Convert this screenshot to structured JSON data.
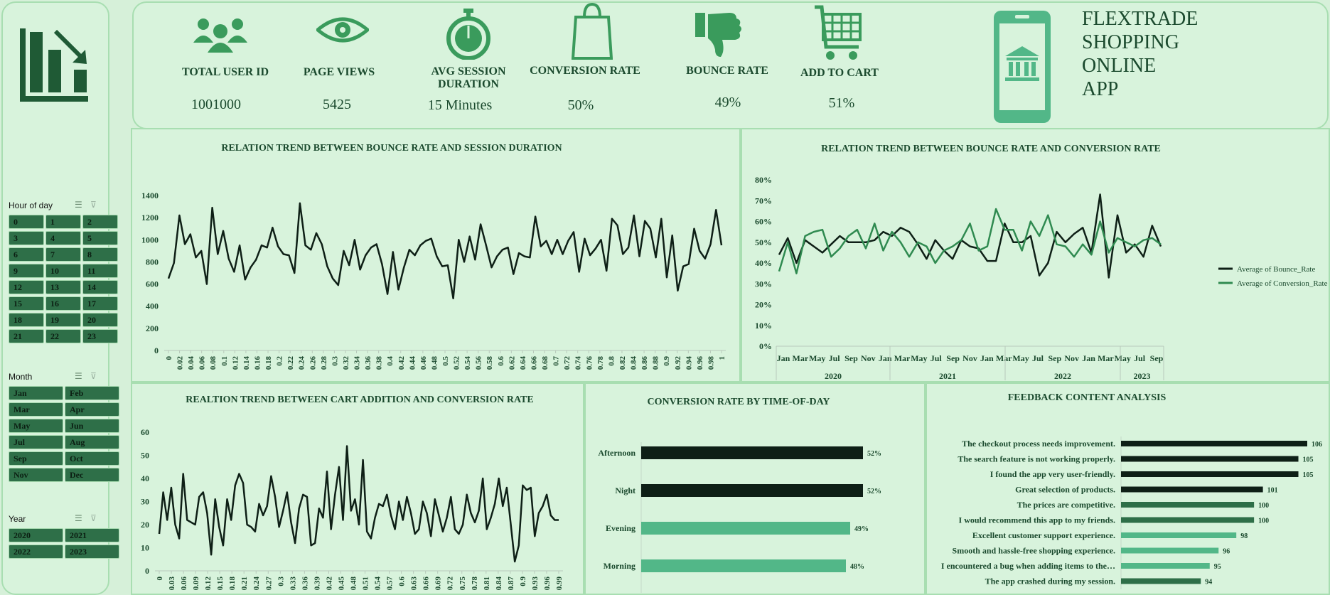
{
  "kpis": [
    {
      "icon": "users-icon",
      "label": "TOTAL USER ID",
      "value": "1001000"
    },
    {
      "icon": "eye-icon",
      "label": "PAGE VIEWS",
      "value": "5425"
    },
    {
      "icon": "stopwatch-icon",
      "label": "AVG SESSION DURATION",
      "value": "15 Minutes"
    },
    {
      "icon": "shopping-bag-icon",
      "label": "CONVERSION RATE",
      "value": "50%"
    },
    {
      "icon": "thumbs-down-icon",
      "label": "BOUNCE RATE",
      "value": "49%"
    },
    {
      "icon": "cart-icon",
      "label": "ADD TO CART",
      "value": "51%"
    }
  ],
  "brand": {
    "line1": "FLEXTRADE",
    "line2": "SHOPPING",
    "line3": "ONLINE",
    "line4": "APP"
  },
  "slicers": {
    "hour": {
      "title": "Hour of day",
      "items": [
        "0",
        "1",
        "2",
        "3",
        "4",
        "5",
        "6",
        "7",
        "8",
        "9",
        "10",
        "11",
        "12",
        "13",
        "14",
        "15",
        "16",
        "17",
        "18",
        "19",
        "20",
        "21",
        "22",
        "23"
      ]
    },
    "month": {
      "title": "Month",
      "items": [
        "Jan",
        "Feb",
        "Mar",
        "Apr",
        "May",
        "Jun",
        "Jul",
        "Aug",
        "Sep",
        "Oct",
        "Nov",
        "Dec"
      ]
    },
    "year": {
      "title": "Year",
      "items": [
        "2020",
        "2021",
        "2022",
        "2023"
      ]
    }
  },
  "colors": {
    "dark": "#0e1f16",
    "green": "#3a9b5c",
    "light_green": "#52b788",
    "bg": "#d8f3dc",
    "accent": "#2e6f48"
  },
  "chart_data": [
    {
      "type": "line",
      "title": "RELATION TREND BETWEEN BOUNCE RATE AND SESSION DURATION",
      "ylim": [
        0,
        1400
      ],
      "yticks": [
        "0",
        "200",
        "400",
        "600",
        "800",
        "1000",
        "1200",
        "1400"
      ],
      "xtick_labels": [
        "0",
        "0.02",
        "0.04",
        "0.06",
        "0.08",
        "0.1",
        "0.12",
        "0.14",
        "0.16",
        "0.18",
        "0.2",
        "0.22",
        "0.24",
        "0.26",
        "0.28",
        "0.3",
        "0.32",
        "0.34",
        "0.36",
        "0.38",
        "0.4",
        "0.42",
        "0.44",
        "0.46",
        "0.48",
        "0.5",
        "0.52",
        "0.54",
        "0.56",
        "0.58",
        "0.6",
        "0.62",
        "0.64",
        "0.66",
        "0.68",
        "0.7",
        "0.72",
        "0.74",
        "0.76",
        "0.78",
        "0.8",
        "0.82",
        "0.84",
        "0.86",
        "0.88",
        "0.9",
        "0.92",
        "0.94",
        "0.96",
        "0.98",
        "1"
      ],
      "values": [
        650,
        790,
        1220,
        960,
        1050,
        840,
        900,
        600,
        1290,
        870,
        1080,
        830,
        710,
        950,
        640,
        750,
        820,
        950,
        930,
        1110,
        940,
        870,
        860,
        700,
        1330,
        950,
        910,
        1060,
        960,
        760,
        650,
        590,
        900,
        770,
        1000,
        730,
        860,
        930,
        960,
        780,
        510,
        890,
        550,
        750,
        910,
        860,
        950,
        990,
        1010,
        850,
        760,
        770,
        470,
        1000,
        800,
        1030,
        820,
        1140,
        950,
        750,
        850,
        910,
        930,
        690,
        880,
        850,
        840,
        1210,
        940,
        990,
        870,
        1000,
        870,
        990,
        1070,
        710,
        1010,
        860,
        920,
        1000,
        720,
        1190,
        1130,
        870,
        930,
        1220,
        850,
        1170,
        1100,
        840,
        1190,
        660,
        1040,
        540,
        760,
        780,
        1100,
        900,
        830,
        960,
        1270,
        950
      ]
    },
    {
      "type": "line",
      "title": "RELATION TREND BETWEEN BOUNCE RATE AND CONVERSION RATE",
      "ylim": [
        0,
        0.8
      ],
      "yticks": [
        "0%",
        "10%",
        "20%",
        "30%",
        "40%",
        "50%",
        "60%",
        "70%",
        "80%"
      ],
      "month_labels": [
        "Jan",
        "Mar",
        "May",
        "Jul",
        "Sep",
        "Nov",
        "Jan",
        "Mar",
        "May",
        "Jul",
        "Sep",
        "Nov",
        "Jan",
        "Mar",
        "May",
        "Jul",
        "Sep",
        "Nov",
        "Jan",
        "Mar",
        "May",
        "Jul",
        "Sep"
      ],
      "year_labels": [
        "2020",
        "2021",
        "2022",
        "2023"
      ],
      "legend_position": "right",
      "series": [
        {
          "name": "Average of Bounce_Rate",
          "values": [
            0.44,
            0.52,
            0.4,
            0.51,
            0.48,
            0.45,
            0.49,
            0.53,
            0.5,
            0.5,
            0.5,
            0.51,
            0.55,
            0.53,
            0.57,
            0.55,
            0.49,
            0.42,
            0.51,
            0.46,
            0.42,
            0.51,
            0.48,
            0.47,
            0.41,
            0.41,
            0.59,
            0.5,
            0.5,
            0.53,
            0.34,
            0.4,
            0.55,
            0.5,
            0.54,
            0.57,
            0.45,
            0.73,
            0.33,
            0.63,
            0.45,
            0.49,
            0.43,
            0.58,
            0.48
          ]
        },
        {
          "name": "Average of Conversion_Rate",
          "values": [
            0.36,
            0.5,
            0.35,
            0.53,
            0.55,
            0.56,
            0.43,
            0.47,
            0.53,
            0.56,
            0.47,
            0.59,
            0.46,
            0.55,
            0.5,
            0.43,
            0.5,
            0.48,
            0.4,
            0.46,
            0.48,
            0.51,
            0.59,
            0.46,
            0.48,
            0.66,
            0.56,
            0.56,
            0.46,
            0.6,
            0.53,
            0.63,
            0.49,
            0.48,
            0.43,
            0.49,
            0.44,
            0.6,
            0.45,
            0.52,
            0.5,
            0.48,
            0.51,
            0.52,
            0.49
          ]
        }
      ]
    },
    {
      "type": "line",
      "title": "REALTION TREND BETWEEN CART ADDITION AND CONVERSION RATE",
      "ylim": [
        0,
        60
      ],
      "yticks": [
        "0",
        "10",
        "20",
        "30",
        "40",
        "50",
        "60"
      ],
      "xtick_labels": [
        "0",
        "0.03",
        "0.06",
        "0.09",
        "0.12",
        "0.15",
        "0.18",
        "0.21",
        "0.24",
        "0.27",
        "0.3",
        "0.33",
        "0.36",
        "0.39",
        "0.42",
        "0.45",
        "0.48",
        "0.51",
        "0.54",
        "0.57",
        "0.6",
        "0.63",
        "0.66",
        "0.69",
        "0.72",
        "0.75",
        "0.78",
        "0.81",
        "0.84",
        "0.87",
        "0.9",
        "0.93",
        "0.96",
        "0.99"
      ],
      "values": [
        16,
        34,
        22,
        36,
        20,
        14,
        42,
        22,
        21,
        20,
        32,
        34,
        25,
        7,
        31,
        19,
        11,
        31,
        22,
        37,
        42,
        38,
        20,
        19,
        17,
        29,
        24,
        28,
        41,
        32,
        19,
        26,
        34,
        21,
        12,
        27,
        33,
        32,
        11,
        12,
        27,
        23,
        43,
        18,
        33,
        45,
        22,
        54,
        26,
        31,
        20,
        48,
        17,
        14,
        23,
        29,
        28,
        33,
        24,
        18,
        30,
        22,
        32,
        25,
        16,
        18,
        30,
        25,
        15,
        31,
        24,
        17,
        23,
        32,
        18,
        16,
        20,
        33,
        25,
        21,
        26,
        40,
        18,
        23,
        29,
        40,
        28,
        36,
        20,
        4,
        11,
        37,
        35,
        36,
        15,
        25,
        28,
        33,
        24,
        22,
        22
      ]
    },
    {
      "type": "bar",
      "orientation": "horizontal",
      "title": "CONVERSION RATE BY TIME-OF-DAY",
      "categories": [
        "Afternoon",
        "Night",
        "Evening",
        "Morning"
      ],
      "values": [
        0.52,
        0.52,
        0.49,
        0.48
      ],
      "value_labels": [
        "52%",
        "52%",
        "49%",
        "48%"
      ],
      "bar_colors": [
        "dark",
        "dark",
        "light",
        "light"
      ]
    },
    {
      "type": "bar",
      "orientation": "horizontal",
      "title": "FEEDBACK CONTENT ANALYSIS",
      "categories": [
        "The checkout process needs improvement.",
        "The search feature is not working properly.",
        "I found the app very user-friendly.",
        "Great selection of products.",
        "The prices are competitive.",
        "I would recommend this app to my friends.",
        "Excellent customer support experience.",
        "Smooth and hassle-free shopping experience.",
        "I encountered a bug when adding items to the…",
        "The app crashed during my session."
      ],
      "values": [
        106,
        105,
        105,
        101,
        100,
        100,
        98,
        96,
        95,
        94
      ],
      "value_labels": [
        "106",
        "105",
        "105",
        "101",
        "100",
        "100",
        "98",
        "96",
        "95",
        "94"
      ],
      "bar_colors": [
        "dark",
        "dark",
        "dark",
        "dark",
        "mid",
        "mid",
        "light",
        "light",
        "light",
        "mid"
      ]
    }
  ]
}
